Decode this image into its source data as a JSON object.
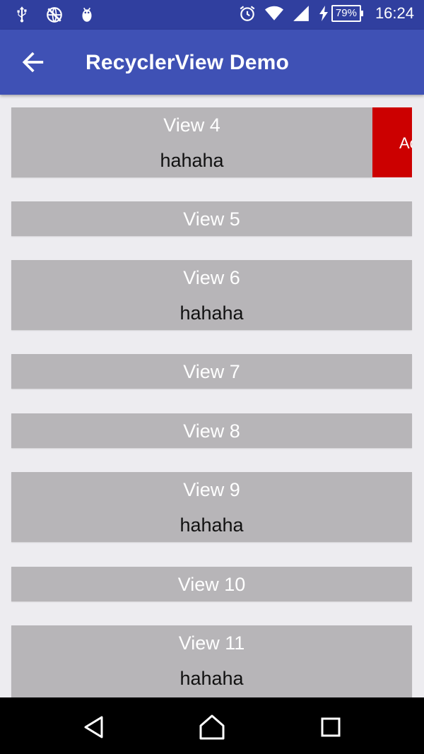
{
  "status_bar": {
    "icons": [
      "usb-icon",
      "no-sim-data-icon",
      "android-debug-icon",
      "alarm-icon",
      "wifi-icon",
      "signal-icon",
      "charging-icon"
    ],
    "battery": "79%",
    "time": "16:24"
  },
  "app_bar": {
    "title": "RecyclerView Demo",
    "back_icon": "arrow-back-icon"
  },
  "list": {
    "items": [
      {
        "title": "View 4",
        "subtitle": "hahaha",
        "swipe_action": "Ac"
      },
      {
        "title": "View 5"
      },
      {
        "title": "View 6",
        "subtitle": "hahaha"
      },
      {
        "title": "View 7"
      },
      {
        "title": "View 8"
      },
      {
        "title": "View 9",
        "subtitle": "hahaha"
      },
      {
        "title": "View 10"
      },
      {
        "title": "View 11",
        "subtitle": "hahaha"
      }
    ]
  },
  "nav_bar": {
    "icons": [
      "back-triangle-icon",
      "home-icon",
      "recents-icon"
    ]
  },
  "colors": {
    "status_bar": "#303f9f",
    "app_bar": "#3f51b5",
    "item_bg": "#b7b5b8",
    "swipe_action_bg": "#cc0000",
    "page_bg": "#edecf0"
  }
}
